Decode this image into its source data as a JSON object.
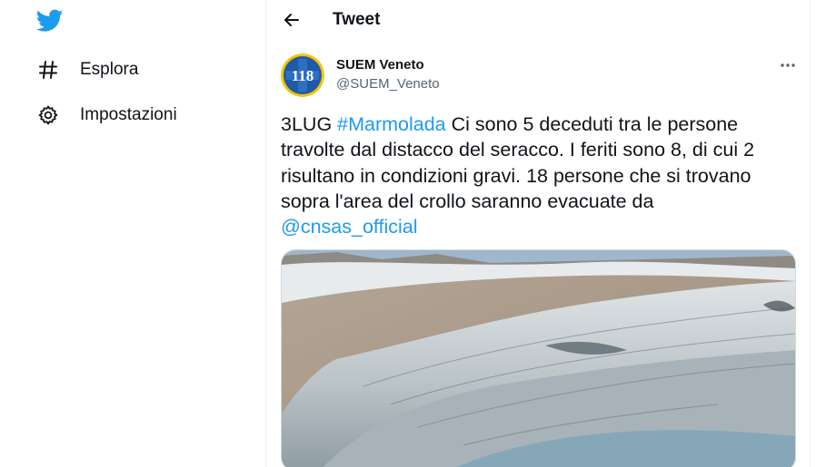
{
  "sidebar": {
    "items": [
      {
        "label": "Esplora",
        "icon": "hashtag-icon"
      },
      {
        "label": "Impostazioni",
        "icon": "gear-icon"
      }
    ]
  },
  "header": {
    "title": "Tweet"
  },
  "tweet": {
    "author": {
      "name": "SUEM Veneto",
      "handle": "@SUEM_Veneto",
      "avatar_text": "118"
    },
    "text_parts": {
      "p1": "3LUG ",
      "hashtag": "#Marmolada",
      "p2": " Ci sono 5 deceduti tra le persone travolte dal distacco del seracco. I feriti sono 8, di cui 2 risultano in condizioni gravi. 18 persone che si trovano sopra l'area del crollo saranno evacuate da ",
      "mention": "@cnsas_official"
    }
  },
  "colors": {
    "accent": "#1d9bf0",
    "text": "#0f1419",
    "secondary": "#536471"
  }
}
